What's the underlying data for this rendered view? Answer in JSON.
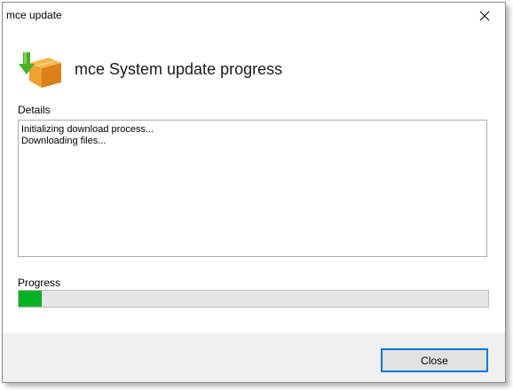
{
  "window": {
    "title": "mce update",
    "close_icon": "close-icon"
  },
  "header": {
    "icon": "package-download-icon",
    "title": "mce System update progress"
  },
  "details": {
    "label": "Details",
    "lines": [
      "Initializing download process...",
      "Downloading files..."
    ]
  },
  "progress": {
    "label": "Progress",
    "percent": 5,
    "fill_color": "#06b025"
  },
  "footer": {
    "close_label": "Close"
  }
}
